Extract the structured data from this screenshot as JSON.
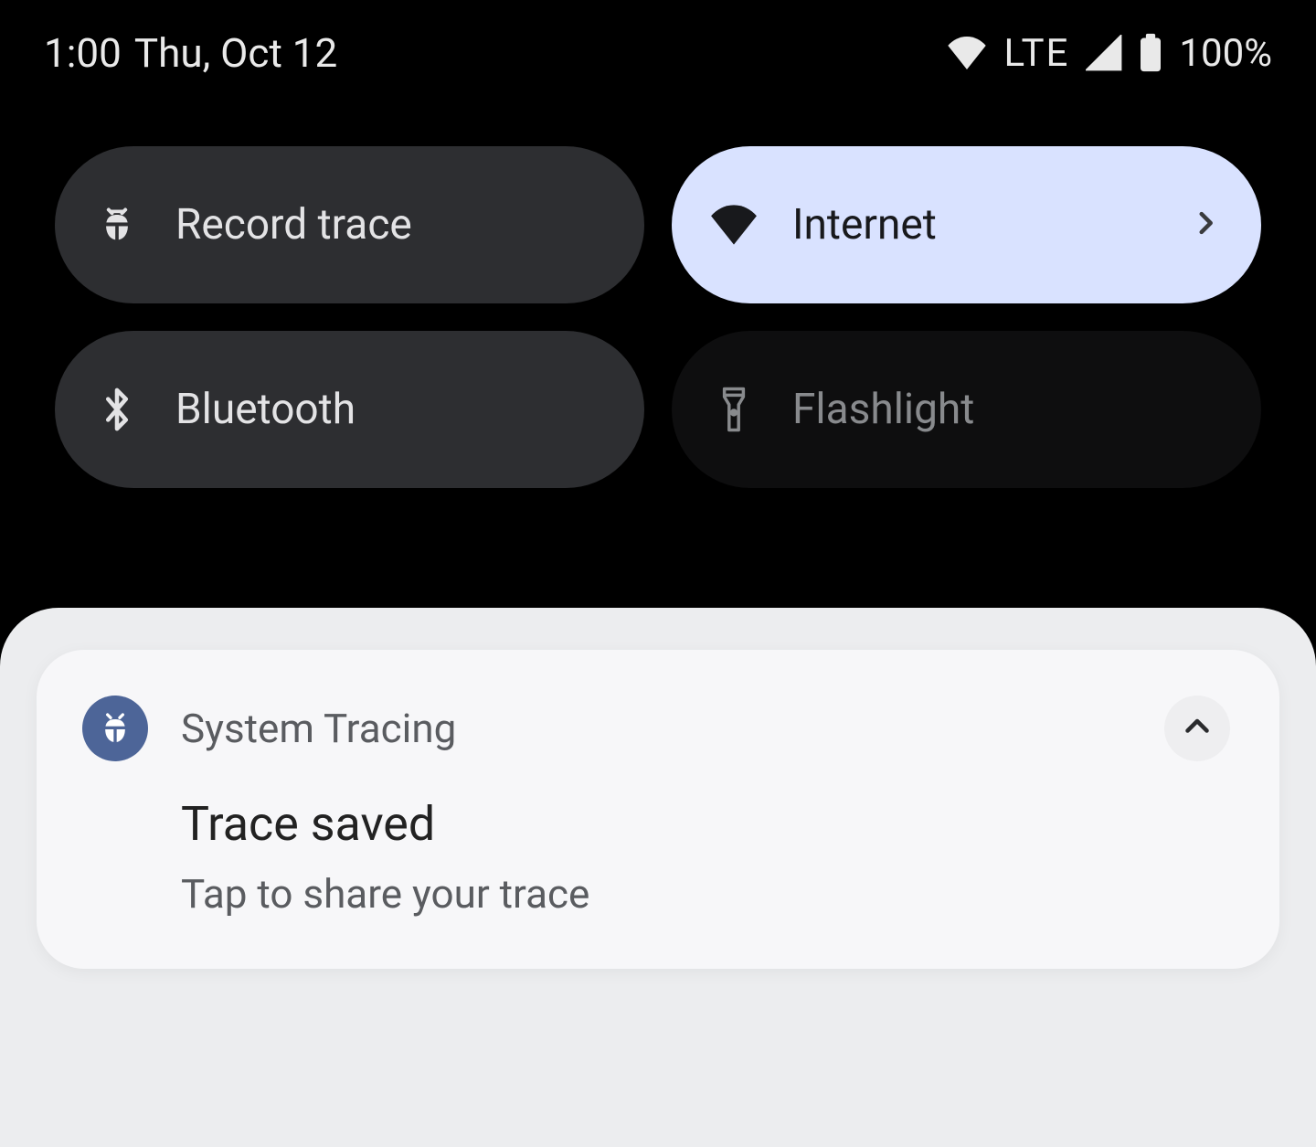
{
  "status": {
    "time": "1:00",
    "date": "Thu, Oct 12",
    "network_label": "LTE",
    "battery_pct": "100%"
  },
  "qs": {
    "tiles": [
      {
        "label": "Record trace",
        "state": "off",
        "icon": "bug",
        "chevron": false
      },
      {
        "label": "Internet",
        "state": "on",
        "icon": "wifi",
        "chevron": true
      },
      {
        "label": "Bluetooth",
        "state": "off",
        "icon": "bluetooth",
        "chevron": false
      },
      {
        "label": "Flashlight",
        "state": "dim",
        "icon": "flash",
        "chevron": false
      }
    ]
  },
  "notification": {
    "app_name": "System Tracing",
    "title": "Trace saved",
    "subtitle": "Tap to share your trace"
  }
}
